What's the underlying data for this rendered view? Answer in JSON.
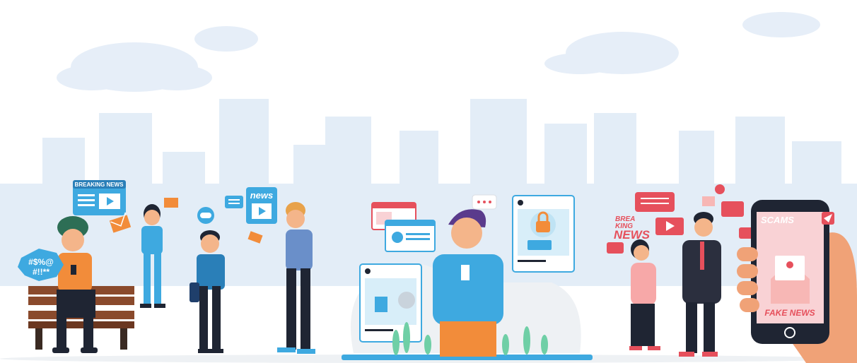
{
  "labels": {
    "breaking_news": "BREAKING NEWS",
    "swear_line1": "#$%@",
    "swear_line2": "#!!**",
    "news": "news",
    "brea": "BREA",
    "king": "KING",
    "news_caps": "NEWS",
    "scams": "SCAMS",
    "fake_news": "FAKE NEWS"
  },
  "colors": {
    "sky_building": "#e3edf7",
    "cloud": "#e6eef8",
    "accent_blue": "#3ea9e0",
    "accent_orange": "#f28c3a",
    "accent_red": "#e6505c",
    "dark": "#1f2533",
    "skin": "#f4b58a",
    "ground": "#eef1f4"
  },
  "icons": [
    "envelope-icon",
    "gamepad-icon",
    "play-icon",
    "lock-icon",
    "chat-icon",
    "paper-plane-icon",
    "bell-icon"
  ]
}
